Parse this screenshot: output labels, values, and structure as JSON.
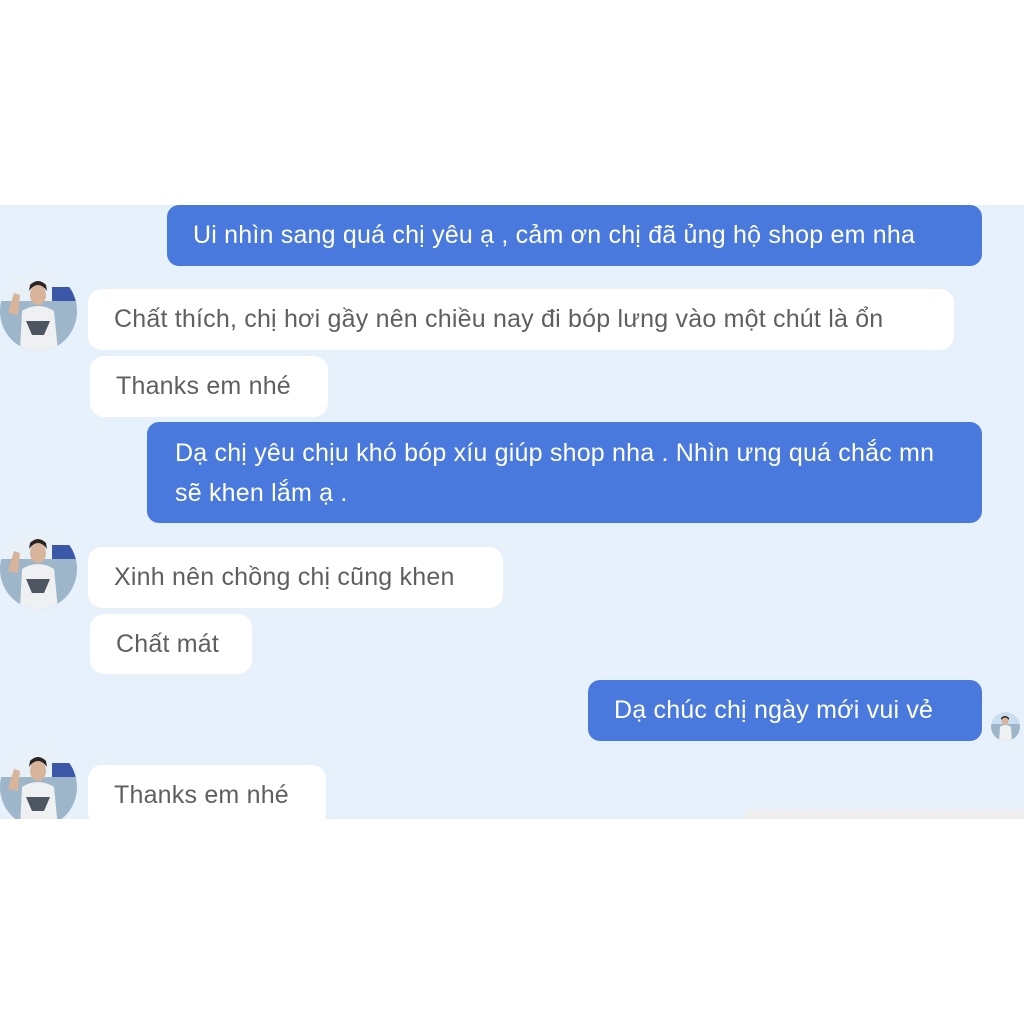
{
  "conversation": {
    "messages": [
      {
        "sender": "shop",
        "text": "Ui nhìn sang quá chị yêu ạ , cảm ơn chị đã ủng hộ shop em nha"
      },
      {
        "sender": "customer",
        "text": "Chất thích, chị hơi gầy nên chiều nay đi bóp lưng vào một chút là ổn"
      },
      {
        "sender": "customer",
        "text": "Thanks em nhé"
      },
      {
        "sender": "shop",
        "text": "Dạ chị yêu chịu khó bóp xíu giúp shop nha . Nhìn ưng quá chắc mn sẽ khen lắm ạ ."
      },
      {
        "sender": "customer",
        "text": "Xinh nên chồng chị cũng khen"
      },
      {
        "sender": "customer",
        "text": "Chất mát"
      },
      {
        "sender": "shop",
        "text": "Dạ chúc chị ngày mới vui vẻ"
      },
      {
        "sender": "customer",
        "text": "Thanks em nhé"
      }
    ]
  },
  "colors": {
    "outgoing_bubble": "#4a79dd",
    "incoming_bubble": "#ffffff",
    "chat_background": "#e6f1fc",
    "incoming_text": "#5f5f63",
    "outgoing_text": "#ffffff"
  },
  "icons": {
    "customer_avatar": "avatar-photo",
    "read_receipt": "small-avatar-photo"
  }
}
